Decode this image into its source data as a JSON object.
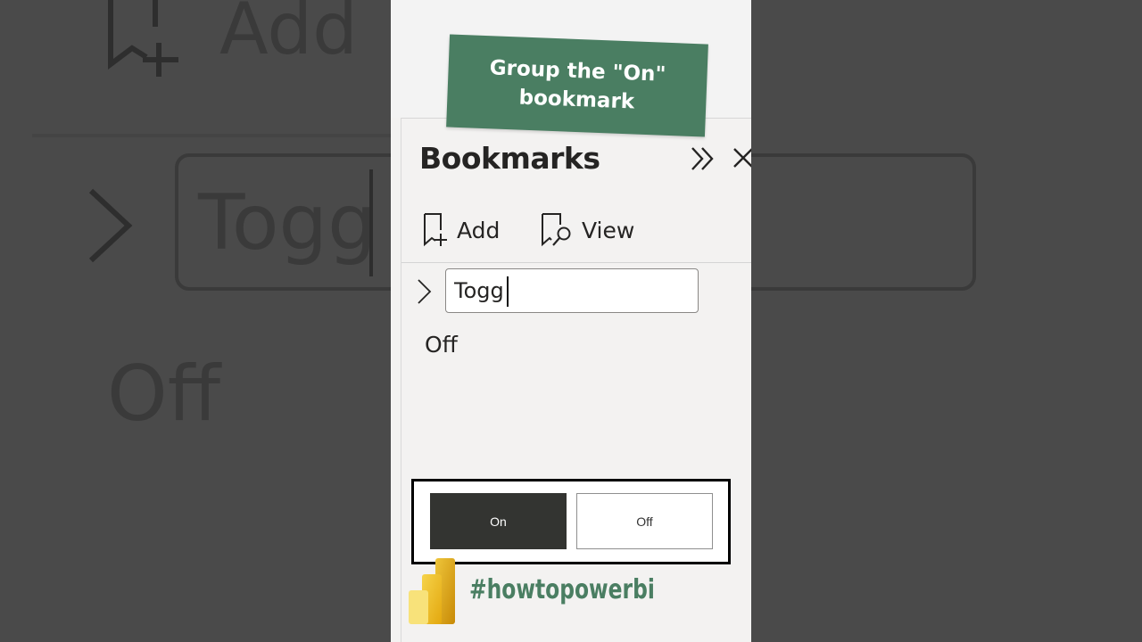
{
  "banner": {
    "text": "Group the \"On\"\nbookmark"
  },
  "bookmarks_pane": {
    "title": "Bookmarks",
    "toolbar": {
      "add_label": "Add",
      "view_label": "View"
    },
    "group_input": {
      "value": "Togg"
    },
    "items": [
      {
        "label": "Off"
      }
    ]
  },
  "toggle_slicer": {
    "buttons": [
      {
        "label": "On",
        "selected": true
      },
      {
        "label": "Off",
        "selected": false
      }
    ]
  },
  "branding": {
    "hashtag": "#howtopowerbi"
  },
  "background_echo": {
    "add_label": "Add",
    "input_text": "Togg",
    "off_label": "Off"
  },
  "icons": [
    "bookmark-add-icon",
    "bookmark-view-icon",
    "expand-pane-icon",
    "close-icon",
    "chevron-right-icon",
    "powerbi-logo-icon"
  ],
  "colors": {
    "accent_green": "#4a7e62",
    "slicer_on_bg": "#333431",
    "pane_bg": "#f3f2f1"
  }
}
